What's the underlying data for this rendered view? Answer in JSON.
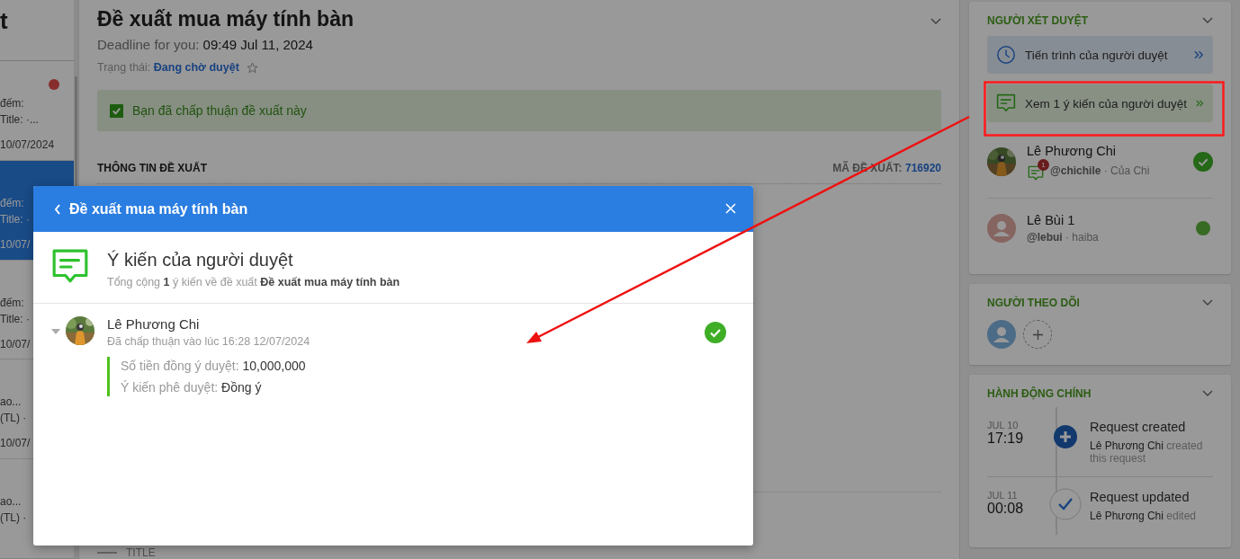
{
  "list_panel": {
    "title_fragment": "t",
    "items": [
      {
        "selected": false,
        "unread": true,
        "lines": [
          "đếm:",
          "Title: ·...",
          "10/07/2024"
        ]
      },
      {
        "selected": true,
        "unread": false,
        "lines": [
          "đếm:",
          "Title: ·",
          "10/07/"
        ]
      },
      {
        "selected": false,
        "unread": false,
        "lines": [
          "đếm:",
          "Title: ·",
          "10/07/"
        ]
      },
      {
        "selected": false,
        "unread": false,
        "lines": [
          "ao...",
          "(TL) ·",
          "10/07/"
        ]
      },
      {
        "selected": false,
        "unread": false,
        "lines": [
          "ao...",
          "(TL) ·"
        ]
      }
    ]
  },
  "request": {
    "title": "Đề xuất mua máy tính bàn",
    "deadline_label": "Deadline for you:",
    "deadline": "09:49 Jul 11, 2024",
    "status_label": "Trạng thái:",
    "status": "Đang chờ duyệt",
    "starred": false,
    "notice": "Bạn đã chấp thuận đề xuất này",
    "notice_checked": true,
    "section_title": "THÔNG TIN ĐỀ XUẤT",
    "code_label": "MÃ ĐỀ XUẤT:",
    "code": "716920",
    "field_label": "TITLE"
  },
  "approvers_card": {
    "title": "NGƯỜI XÉT DUYỆT",
    "progress_button": "Tiến trình của người duyệt",
    "comments_button": "Xem 1 ý kiến của người duyệt",
    "approvers": [
      {
        "name": "Lê Phương Chi",
        "info": "**@chichile** · Của Chi",
        "comment_count": "1",
        "approved": true,
        "has_photo": true
      },
      {
        "name": "Lê Bùi 1",
        "info": "**@lebui** · haiba",
        "approved": false,
        "has_photo": false
      }
    ]
  },
  "followers_card": {
    "title": "NGƯỜI THEO DÕI"
  },
  "actions_card": {
    "title": "HÀNH ĐỘNG CHÍNH",
    "events": [
      {
        "kind": "created",
        "date": "JUL 10",
        "time": "17:19",
        "title": "Request created",
        "actor": "Lê Phương Chi",
        "action": "created this request"
      },
      {
        "kind": "updated",
        "date": "JUL 11",
        "time": "00:08",
        "title": "Request updated",
        "actor": "Lê Phương Chi",
        "action": "edited"
      }
    ]
  },
  "modal": {
    "title": "Đề xuất mua máy tính bàn",
    "heading": "Ý kiến của người duyệt",
    "summary": "Tổng cộng **1** ý kiến về đề xuất **Đề xuất mua máy tính bàn**",
    "comments": [
      {
        "name": "Lê Phương Chi",
        "time": "Đã chấp thuận vào lúc 16:28 12/07/2024",
        "expanded": true,
        "approved": true,
        "fields": [
          {
            "label": "Số tiền đồng ý duyệt:",
            "value": "10,000,000"
          },
          {
            "label": "Ý kiến phê duyệt:",
            "value": "Đồng ý"
          }
        ]
      }
    ]
  }
}
